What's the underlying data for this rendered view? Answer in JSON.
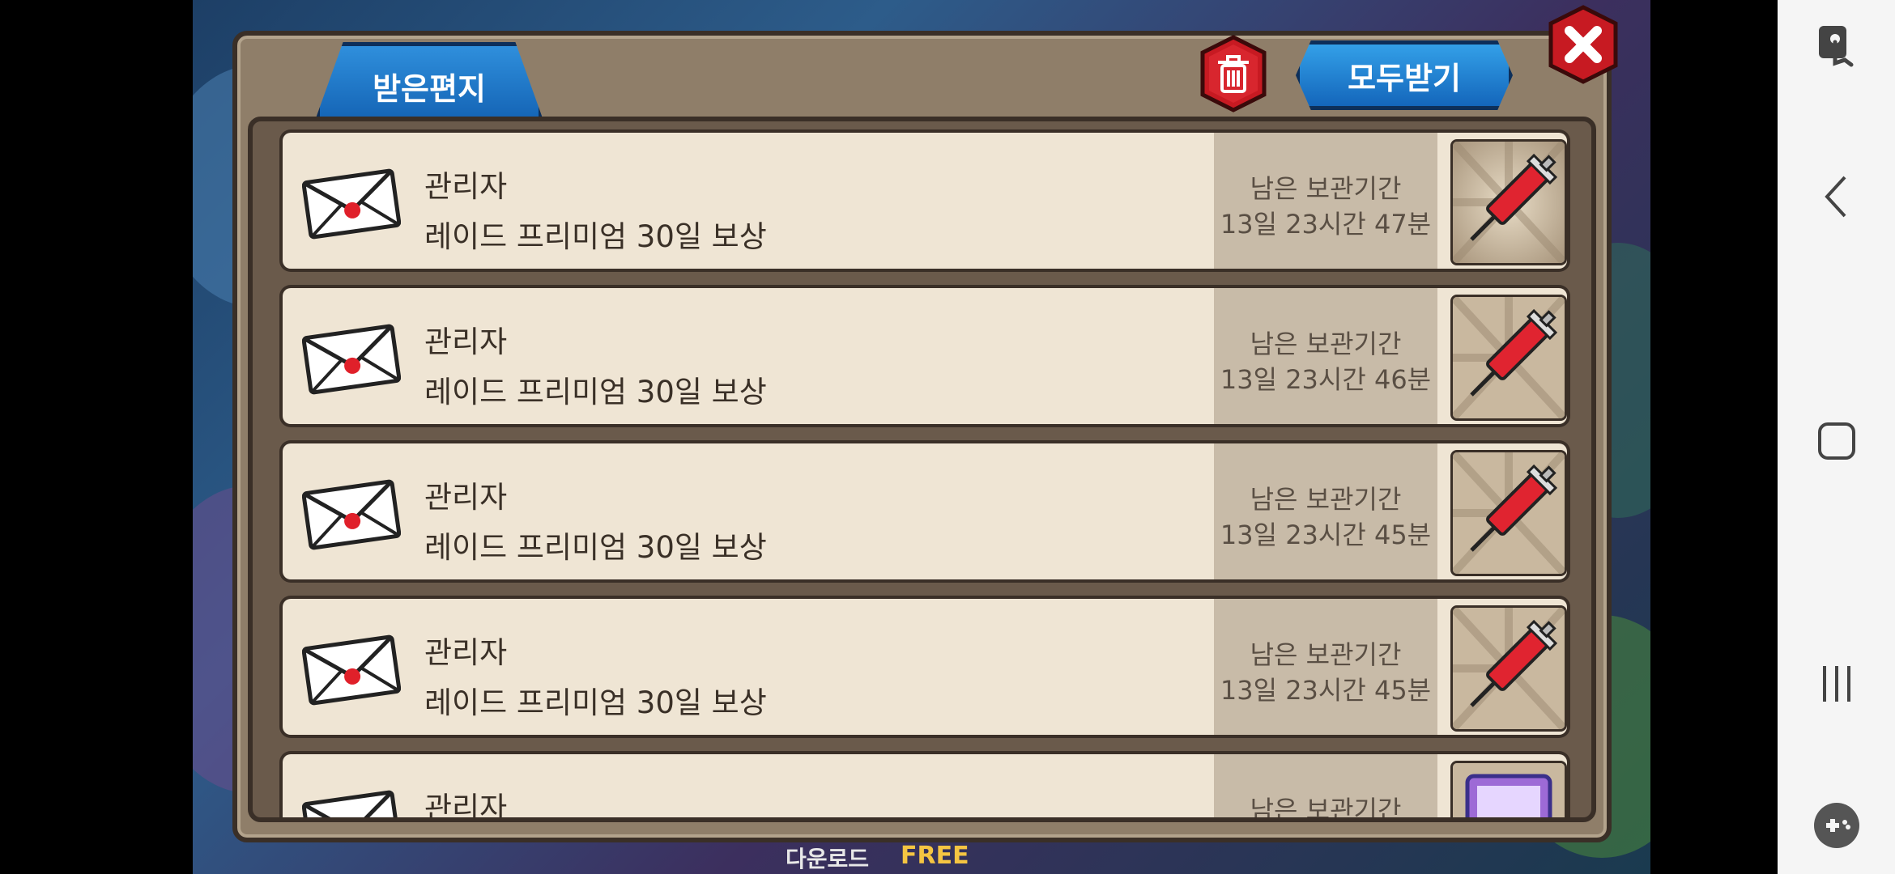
{
  "dialog": {
    "tab_label": "받은편지",
    "receive_all_label": "모두받기"
  },
  "mails": [
    {
      "sender": "관리자",
      "subject": "레이드 프리미엄 30일 보상",
      "expiry_label": "남은 보관기간",
      "expiry_time": "13일 23시간 47분",
      "reward_icon": "syringe-icon"
    },
    {
      "sender": "관리자",
      "subject": "레이드 프리미엄 30일 보상",
      "expiry_label": "남은 보관기간",
      "expiry_time": "13일 23시간 46분",
      "reward_icon": "syringe-icon"
    },
    {
      "sender": "관리자",
      "subject": "레이드 프리미엄 30일 보상",
      "expiry_label": "남은 보관기간",
      "expiry_time": "13일 23시간 45분",
      "reward_icon": "syringe-icon"
    },
    {
      "sender": "관리자",
      "subject": "레이드 프리미엄 30일 보상",
      "expiry_label": "남은 보관기간",
      "expiry_time": "13일 23시간 45분",
      "reward_icon": "syringe-icon"
    },
    {
      "sender": "관리자",
      "subject": "",
      "expiry_label": "남은 보관기간",
      "expiry_time": "",
      "reward_icon": "card-icon"
    }
  ],
  "background": {
    "download_text": "다운로드",
    "free_text": "FREE"
  },
  "nav": {
    "icons": [
      "touch-icon",
      "back-icon",
      "home-icon",
      "recents-icon",
      "game-tools-icon"
    ]
  },
  "colors": {
    "blue_button": "#1466bb",
    "red_button": "#c71a22",
    "row_bg": "#efe5d4",
    "panel_bg": "#8f7e69"
  }
}
